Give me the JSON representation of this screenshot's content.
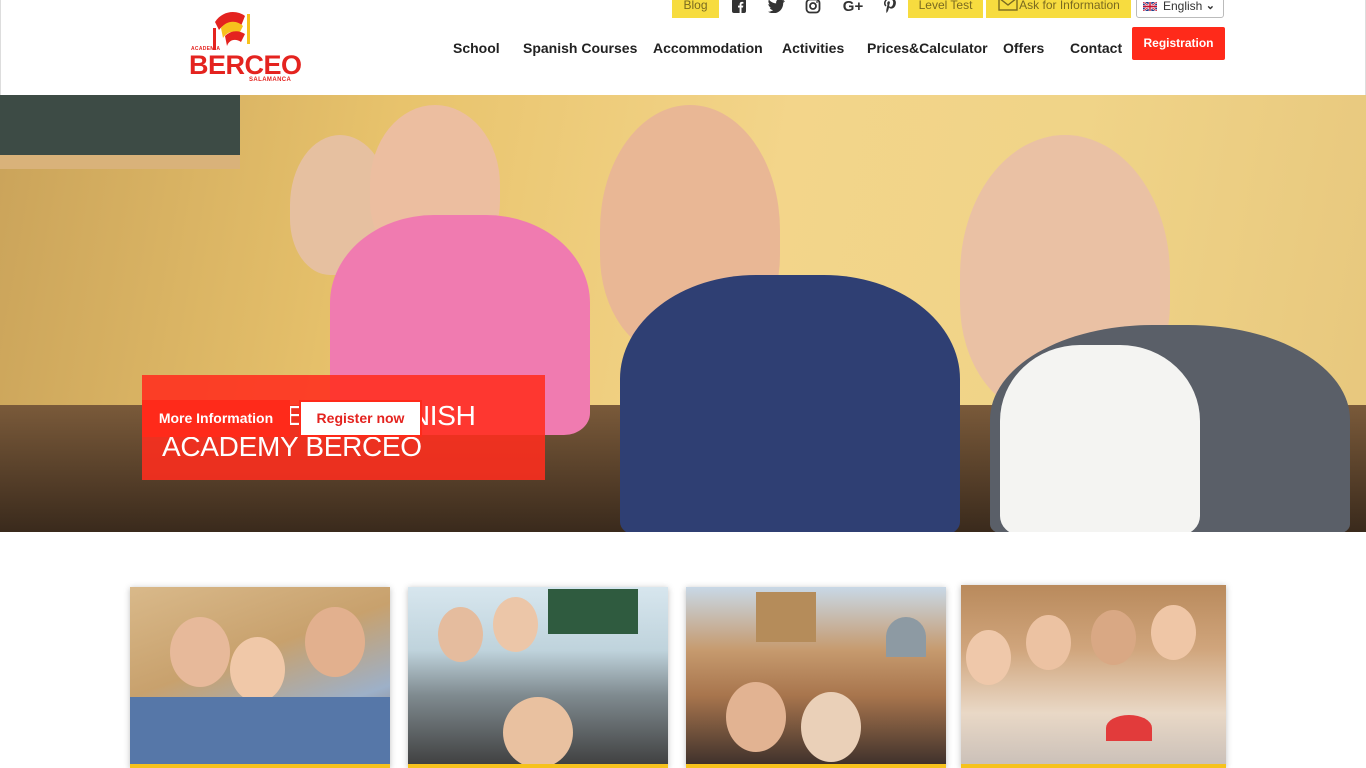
{
  "brand": {
    "small_top": "ACADEMIA",
    "name": "BERCEO",
    "city": "SALAMANCA"
  },
  "topbar": {
    "blog": "Blog",
    "level_test": "Level Test",
    "ask_info": "Ask for Information",
    "language": "English",
    "social_icons": [
      "facebook-icon",
      "twitter-icon",
      "instagram-icon",
      "google-plus-icon",
      "pinterest-icon"
    ]
  },
  "nav": {
    "items": [
      "School",
      "Spanish Courses",
      "Accommodation",
      "Activities",
      "Prices&Calculator",
      "Offers",
      "Contact"
    ],
    "registration": "Registration"
  },
  "hero": {
    "title": "WELCOME TO SPANISH ACADEMY BERCEO",
    "more_button": "More Information",
    "register_button": "Register now"
  },
  "colors": {
    "accent_red": "#ff2a1a",
    "yellow": "#f7dc3f",
    "card_bar": "#f6c21d"
  }
}
